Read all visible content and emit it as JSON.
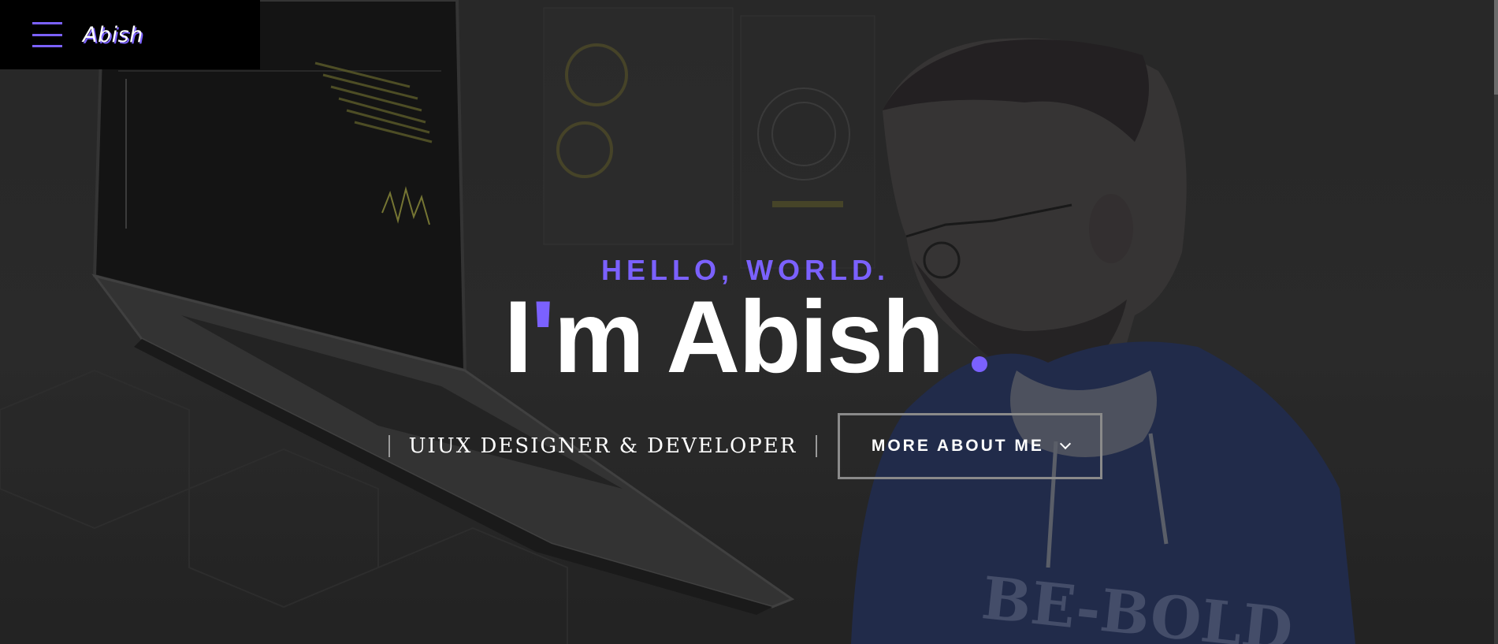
{
  "header": {
    "brand": "Abish",
    "menu_icon": "hamburger-menu-icon"
  },
  "hero": {
    "greeting": "HELLO, WORLD.",
    "title_prefix": "I",
    "title_apostrophe": "'",
    "title_rest": "m Abish",
    "role": "UIUX DESIGNER & DEVELOPER",
    "more_button_label": "MORE ABOUT ME",
    "more_button_icon": "chevron-down-icon"
  },
  "colors": {
    "accent": "#7b61ff",
    "header_bg": "#000000",
    "text": "#ffffff"
  }
}
